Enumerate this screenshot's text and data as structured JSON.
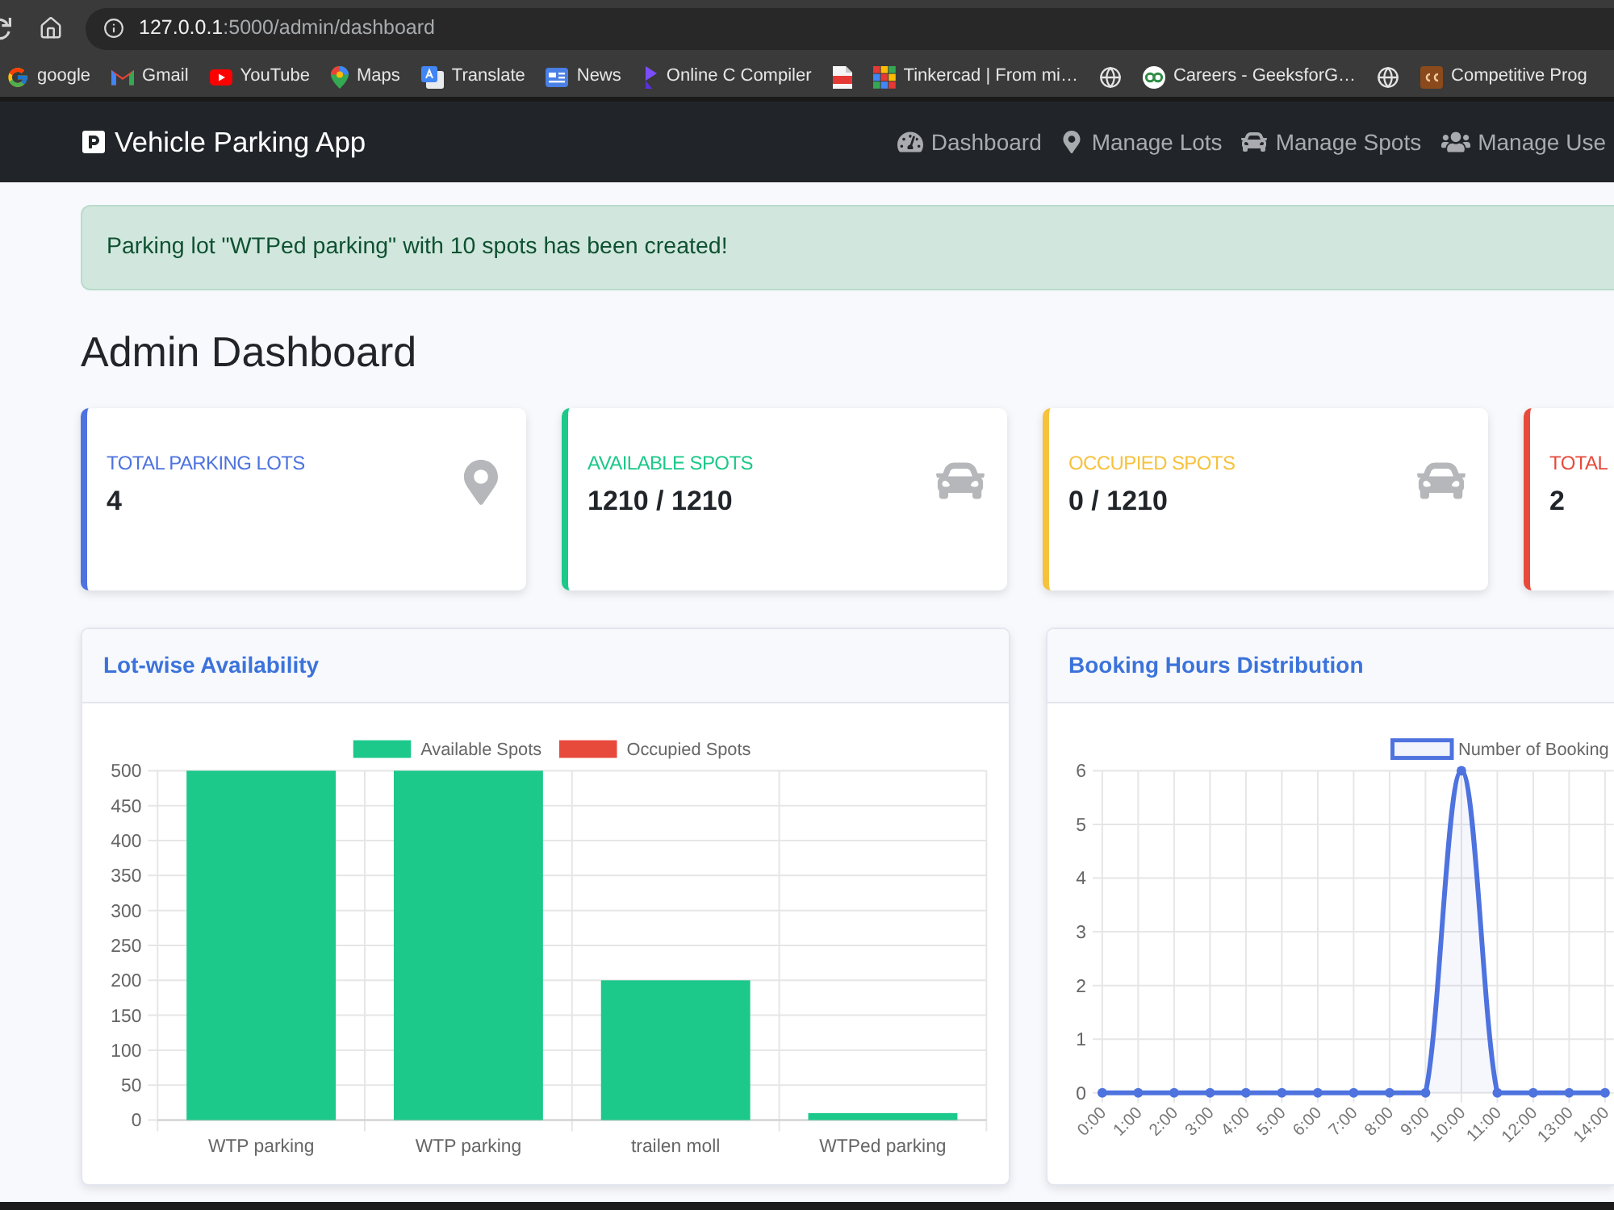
{
  "browser": {
    "url_host": "127.0.0.1",
    "url_path": ":5000/admin/dashboard",
    "bookmarks": [
      {
        "kind": "titled",
        "label": "google"
      },
      {
        "kind": "titled",
        "label": "Gmail"
      },
      {
        "kind": "titled",
        "label": "YouTube"
      },
      {
        "kind": "titled",
        "label": "Maps"
      },
      {
        "kind": "titled",
        "label": "Translate"
      },
      {
        "kind": "titled",
        "label": "News"
      },
      {
        "kind": "titled",
        "label": "Online C Compiler"
      },
      {
        "kind": "icon_only"
      },
      {
        "kind": "titled",
        "label": "Tinkercad | From mi…"
      },
      {
        "kind": "icon_only"
      },
      {
        "kind": "titled",
        "label": "Careers - GeeksforG…"
      },
      {
        "kind": "icon_only"
      },
      {
        "kind": "titled",
        "label": "Competitive Prog"
      }
    ]
  },
  "navbar": {
    "brand": "Vehicle Parking App",
    "links": [
      {
        "label": "Dashboard"
      },
      {
        "label": "Manage Lots"
      },
      {
        "label": "Manage Spots"
      },
      {
        "label": "Manage Use"
      }
    ]
  },
  "alert": {
    "message": "Parking lot \"WTPed parking\" with 10 spots has been created!"
  },
  "page_title": "Admin Dashboard",
  "stat_cards": [
    {
      "label": "TOTAL PARKING LOTS",
      "value": "4",
      "color": "#4e73df"
    },
    {
      "label": "AVAILABLE SPOTS",
      "value": "1210 / 1210",
      "color": "#1cc88a"
    },
    {
      "label": "OCCUPIED SPOTS",
      "value": "0 / 1210",
      "color": "#f6c23e"
    },
    {
      "label": "TOTAL",
      "value": "2",
      "color": "#e74a3b"
    }
  ],
  "lot_chart": {
    "title": "Lot-wise Availability",
    "chart_data": {
      "type": "bar",
      "categories": [
        "WTP parking",
        "WTP parking",
        "trailen moll",
        "WTPed parking"
      ],
      "series": [
        {
          "name": "Available Spots",
          "color": "#1cc88a",
          "values": [
            500,
            500,
            200,
            10
          ]
        },
        {
          "name": "Occupied Spots",
          "color": "#e74a3b",
          "values": [
            0,
            0,
            0,
            0
          ]
        }
      ],
      "stacked": true,
      "grid": true,
      "ylim": [
        0,
        500
      ],
      "yticks": [
        0,
        50,
        100,
        150,
        200,
        250,
        300,
        350,
        400,
        450,
        500
      ]
    }
  },
  "hours_chart": {
    "title": "Booking Hours Distribution",
    "chart_data": {
      "type": "area",
      "x": [
        "0:00",
        "1:00",
        "2:00",
        "3:00",
        "4:00",
        "5:00",
        "6:00",
        "7:00",
        "8:00",
        "9:00",
        "10:00",
        "11:00",
        "12:00",
        "13:00",
        "14:00"
      ],
      "series": [
        {
          "name": "Number of Booking",
          "color": "#4e73df",
          "marker": "circle",
          "values": [
            0,
            0,
            0,
            0,
            0,
            0,
            0,
            0,
            0,
            0,
            6,
            0,
            0,
            0,
            0
          ]
        }
      ],
      "grid": true,
      "ylim": [
        0,
        6
      ],
      "yticks": [
        0,
        1,
        2,
        3,
        4,
        5,
        6
      ]
    }
  }
}
